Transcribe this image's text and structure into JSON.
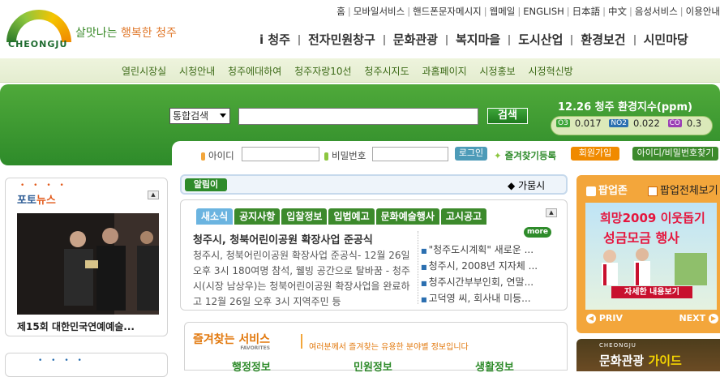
{
  "brand": {
    "logo_word": "CHEONGJU",
    "slogan_a": "살맛나는 ",
    "slogan_b": "행복한 청주"
  },
  "top_links": [
    "홈",
    "모바일서비스",
    "핸드폰문자메시지",
    "웹메일",
    "ENGLISH",
    "日本語",
    "中文",
    "음성서비스",
    "이용안내"
  ],
  "main_nav": [
    "i 청주",
    "전자민원창구",
    "문화관광",
    "복지마을",
    "도시산업",
    "환경보건",
    "시민마당"
  ],
  "sub_nav": [
    "열린시장실",
    "시청안내",
    "청주에대하여",
    "청주자랑10선",
    "청주시지도",
    "과홈페이지",
    "시정홍보",
    "시정혁신방"
  ],
  "search": {
    "scope_value": "통합검색",
    "button_label": "검색",
    "query_value": ""
  },
  "environment": {
    "title": "12.26 청주  환경지수(ppm)",
    "readings": [
      {
        "gas": "O3",
        "value": "0.017",
        "color": "#3ea63a"
      },
      {
        "gas": "NO2",
        "value": "0.022",
        "color": "#2b6fb0"
      },
      {
        "gas": "CO",
        "value": "0.3",
        "color": "#9b3fb5"
      }
    ]
  },
  "login": {
    "id_label": "아이디",
    "pw_label": "비밀번호",
    "login_button": "로그인",
    "favorites_label": "즐겨찾기등록",
    "signup_button": "회원가입",
    "find_button": "아이디/비밀번호찾기"
  },
  "photo_news": {
    "title_a": "포토",
    "title_b": "뉴스",
    "caption": "제15회 대한민국연예예술..."
  },
  "notice": {
    "tag": "알림이",
    "text": "◆ 가뭄시"
  },
  "news": {
    "tabs": [
      "새소식",
      "공지사항",
      "입찰정보",
      "입법예고",
      "문화예술행사",
      "고시공고"
    ],
    "active_tab": 0,
    "more_label": "more",
    "headline": "청주시, 청북어린이공원 확장사업 준공식",
    "summary": "청주시, 청북어린이공원 확장사업 준공식- 12월 26일 오후 3시 180여명 참석, 웰빙 공간으로 탈바꿈 - 청주시(시장 남상우)는 청북어린이공원 확장사업을 완료하고 12월 26일 오후 3시 지역주민 등",
    "list": [
      "\"청주도시계획\" 새로운 ...",
      "청주시, 2008년 지자체 ...",
      "청주시간부부인회, 연말...",
      "고덕영 씨, 회사내 미등..."
    ]
  },
  "favorites": {
    "title": "즐겨찾는 서비스",
    "subtitle": "FAVORITES",
    "description": "여러분께서 즐겨찾는 유용한 분야별 정보입니다",
    "columns": [
      "행정정보",
      "민원정보",
      "생활정보"
    ]
  },
  "popup": {
    "title": "팝업존",
    "all_label": "팝업전체보기",
    "banner_line1": "희망2009 이웃돕기",
    "banner_line2": "성금모금 행사",
    "banner_button": "자세한 내용보기",
    "prev_label": "PRIV",
    "next_label": "NEXT"
  },
  "tour_banner": {
    "sub": "CHEONGJU",
    "title_a": "문화관광 ",
    "title_b": "가이드"
  }
}
